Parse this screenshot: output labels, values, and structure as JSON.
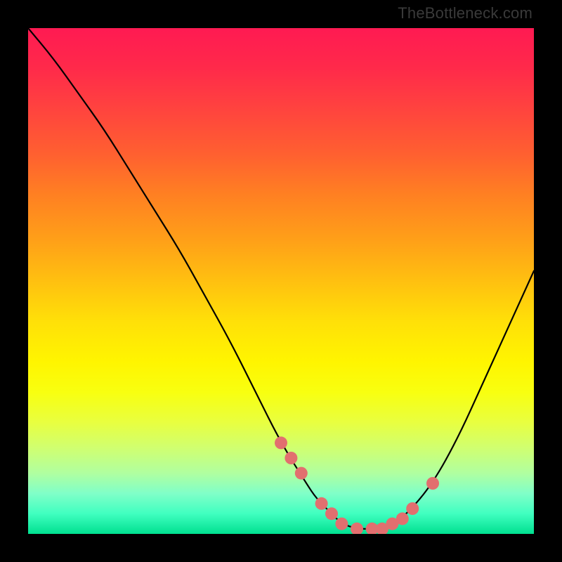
{
  "watermark": "TheBottleneck.com",
  "chart_data": {
    "type": "line",
    "title": "",
    "xlabel": "",
    "ylabel": "",
    "xlim": [
      0,
      100
    ],
    "ylim": [
      0,
      100
    ],
    "grid": false,
    "legend": false,
    "curve": {
      "name": "bottleneck-curve",
      "x": [
        0,
        5,
        10,
        15,
        20,
        25,
        30,
        35,
        40,
        45,
        50,
        55,
        57,
        60,
        62,
        65,
        68,
        70,
        72,
        75,
        80,
        85,
        90,
        95,
        100
      ],
      "y": [
        100,
        94,
        87,
        80,
        72,
        64,
        56,
        47,
        38,
        28,
        18,
        10,
        7,
        4,
        2,
        1,
        1,
        1,
        2,
        4,
        10,
        19,
        30,
        41,
        52
      ]
    },
    "markers": {
      "name": "highlight-points",
      "color": "#e26f6f",
      "radius": 9,
      "x": [
        50,
        52,
        54,
        58,
        60,
        62,
        65,
        68,
        70,
        72,
        74,
        76,
        80
      ],
      "y": [
        18,
        15,
        12,
        6,
        4,
        2,
        1,
        1,
        1,
        2,
        3,
        5,
        10
      ]
    },
    "background_gradient": {
      "top": "#ff1a52",
      "bottom": "#00e090"
    }
  }
}
